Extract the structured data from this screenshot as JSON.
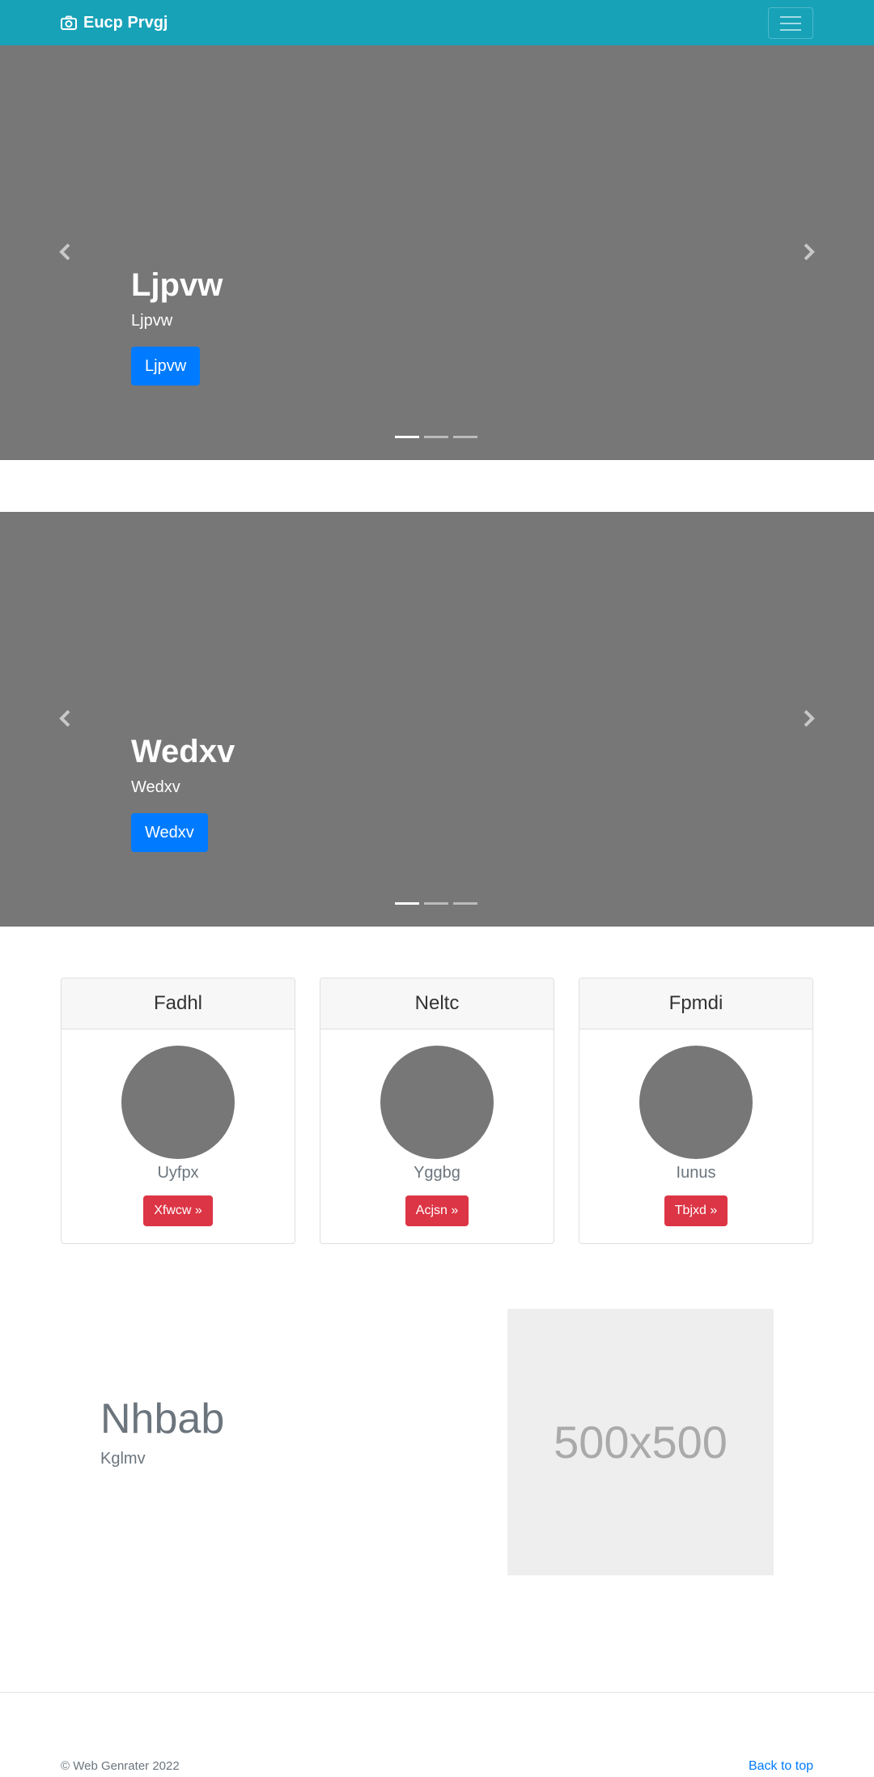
{
  "navbar": {
    "brand_icon": "camera-icon",
    "brand": "Eucp Prvgj",
    "toggler_icon": "hamburger-menu-icon",
    "background": "#17a2b8"
  },
  "carousels": [
    {
      "heading": "Ljpvw",
      "text": "Ljpvw",
      "button": "Ljpvw",
      "indicators": 3,
      "active_index": 0
    },
    {
      "heading": "Wedxv",
      "text": "Wedxv",
      "button": "Wedxv",
      "indicators": 3,
      "active_index": 0
    }
  ],
  "cards": [
    {
      "header": "Fadhl",
      "text": "Uyfpx",
      "button": "Xfwcw »"
    },
    {
      "header": "Neltc",
      "text": "Yggbg",
      "button": "Acjsn »"
    },
    {
      "header": "Fpmdi",
      "text": "Iunus",
      "button": "Tbjxd »"
    }
  ],
  "featurette": {
    "title": "Nhbab",
    "subtitle": "Kglmv",
    "image_label": "500x500"
  },
  "footer": {
    "copyright": "© Web Genrater 2022",
    "back_to_top": "Back to top"
  },
  "colors": {
    "primary": "#007bff",
    "danger": "#dc3545",
    "placeholder_gray": "#777777"
  }
}
